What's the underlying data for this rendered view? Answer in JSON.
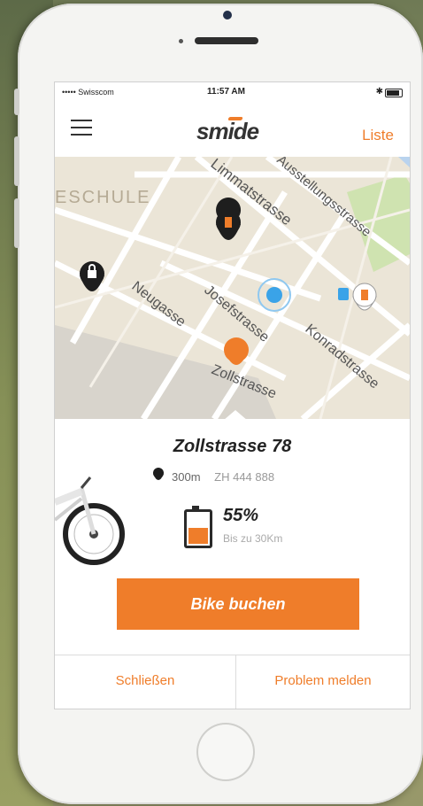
{
  "status_bar": {
    "carrier": "••••• Swisscom",
    "time": "11:57 AM",
    "bluetooth": "✱"
  },
  "header": {
    "logo": "smide",
    "list_link": "Liste"
  },
  "map": {
    "streets": [
      "Limmatstrasse",
      "Ausstellungsstrasse",
      "Neugasse",
      "Josefstrasse",
      "Konradstrasse",
      "Zollstrasse"
    ],
    "area_label": "ESCHULE"
  },
  "bike": {
    "address": "Zollstrasse 78",
    "distance": "300m",
    "plate": "ZH 444 888",
    "battery_percent": "55%",
    "battery_level": 0.55,
    "range": "Bis zu 30Km"
  },
  "actions": {
    "book": "Bike buchen",
    "close": "Schließen",
    "report": "Problem melden"
  },
  "colors": {
    "accent": "#ef7d2a",
    "map_background": "#ebe5d7",
    "pin_dark": "#1e1e1e",
    "location_blue": "#3aa3e8"
  }
}
